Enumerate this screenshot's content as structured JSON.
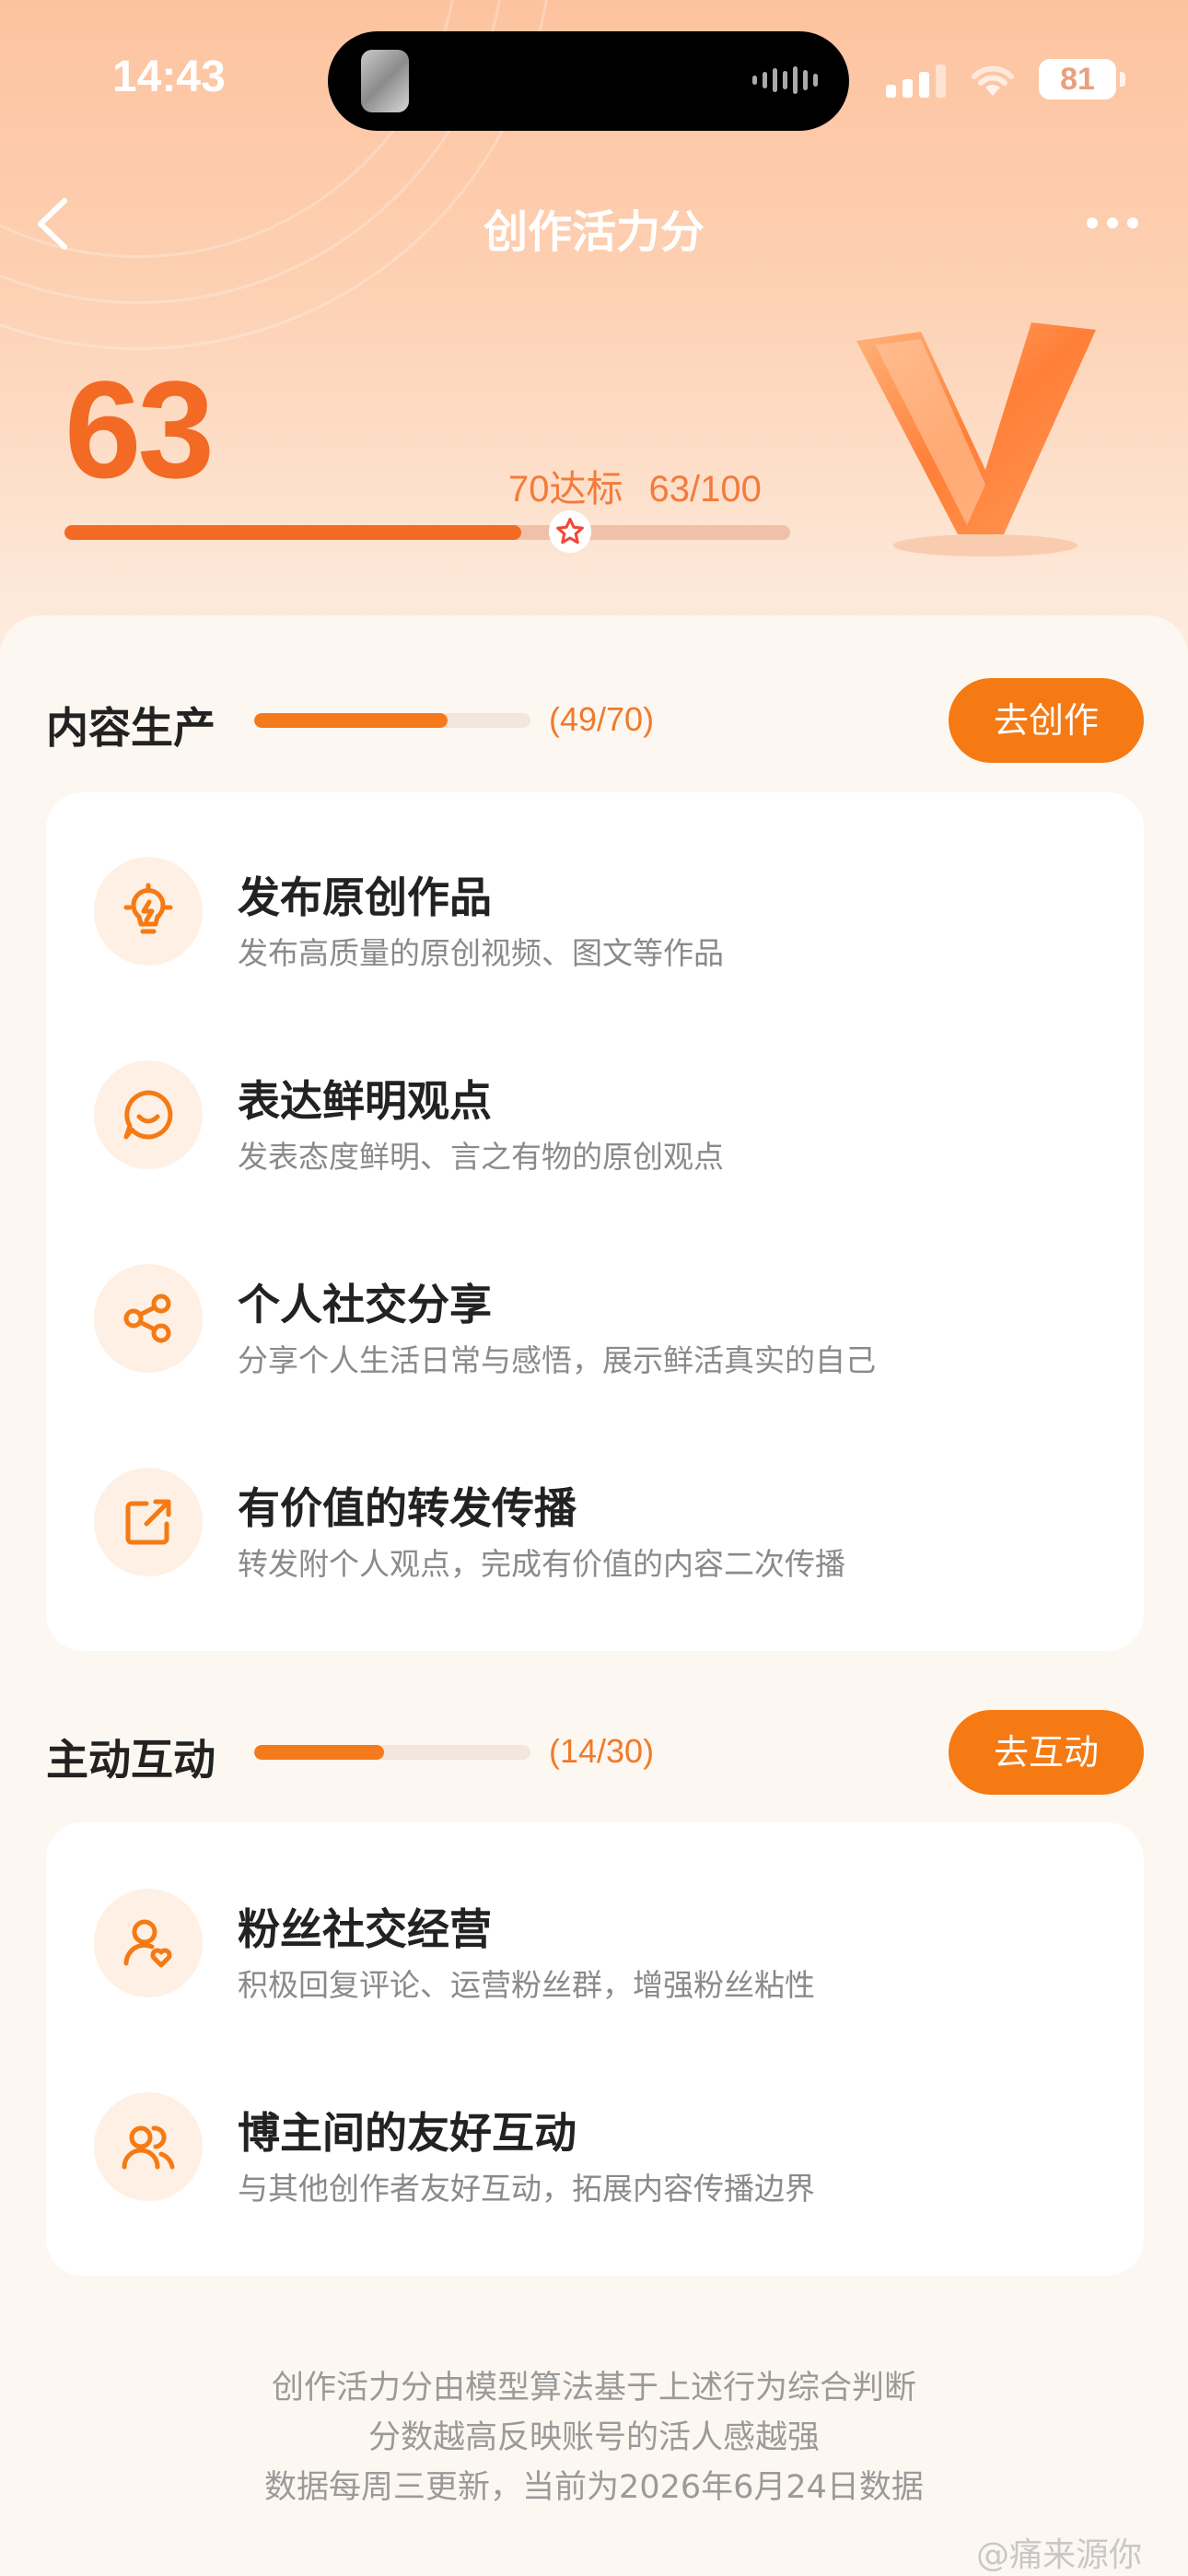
{
  "status_bar": {
    "time": "14:43",
    "battery": "81"
  },
  "nav": {
    "title": "创作活力分"
  },
  "score": {
    "value": "63",
    "target_label": "70达标",
    "progress_label": "63/100",
    "progress": 0.63
  },
  "sections": [
    {
      "title": "内容生产",
      "count": "(49/70)",
      "progress": 0.7,
      "button": "去创作",
      "items": [
        {
          "icon": "lightbulb-icon",
          "title": "发布原创作品",
          "desc": "发布高质量的原创视频、图文等作品"
        },
        {
          "icon": "chat-smile-icon",
          "title": "表达鲜明观点",
          "desc": "发表态度鲜明、言之有物的原创观点"
        },
        {
          "icon": "share-icon",
          "title": "个人社交分享",
          "desc": "分享个人生活日常与感悟，展示鲜活真实的自己"
        },
        {
          "icon": "repost-icon",
          "title": "有价值的转发传播",
          "desc": "转发附个人观点，完成有价值的内容二次传播"
        }
      ]
    },
    {
      "title": "主动互动",
      "count": "(14/30)",
      "progress": 0.47,
      "button": "去互动",
      "items": [
        {
          "icon": "user-heart-icon",
          "title": "粉丝社交经营",
          "desc": "积极回复评论、运营粉丝群，增强粉丝粘性"
        },
        {
          "icon": "users-icon",
          "title": "博主间的友好互动",
          "desc": "与其他创作者友好互动，拓展内容传播边界"
        }
      ]
    }
  ],
  "footer": {
    "line1": "创作活力分由模型算法基于上述行为综合判断",
    "line2": "分数越高反映账号的活人感越强",
    "line3": "数据每周三更新，当前为2026年6月24日数据"
  },
  "watermark": "@痛来源你",
  "colors": {
    "accent": "#f57a14",
    "score": "#f26a24"
  }
}
